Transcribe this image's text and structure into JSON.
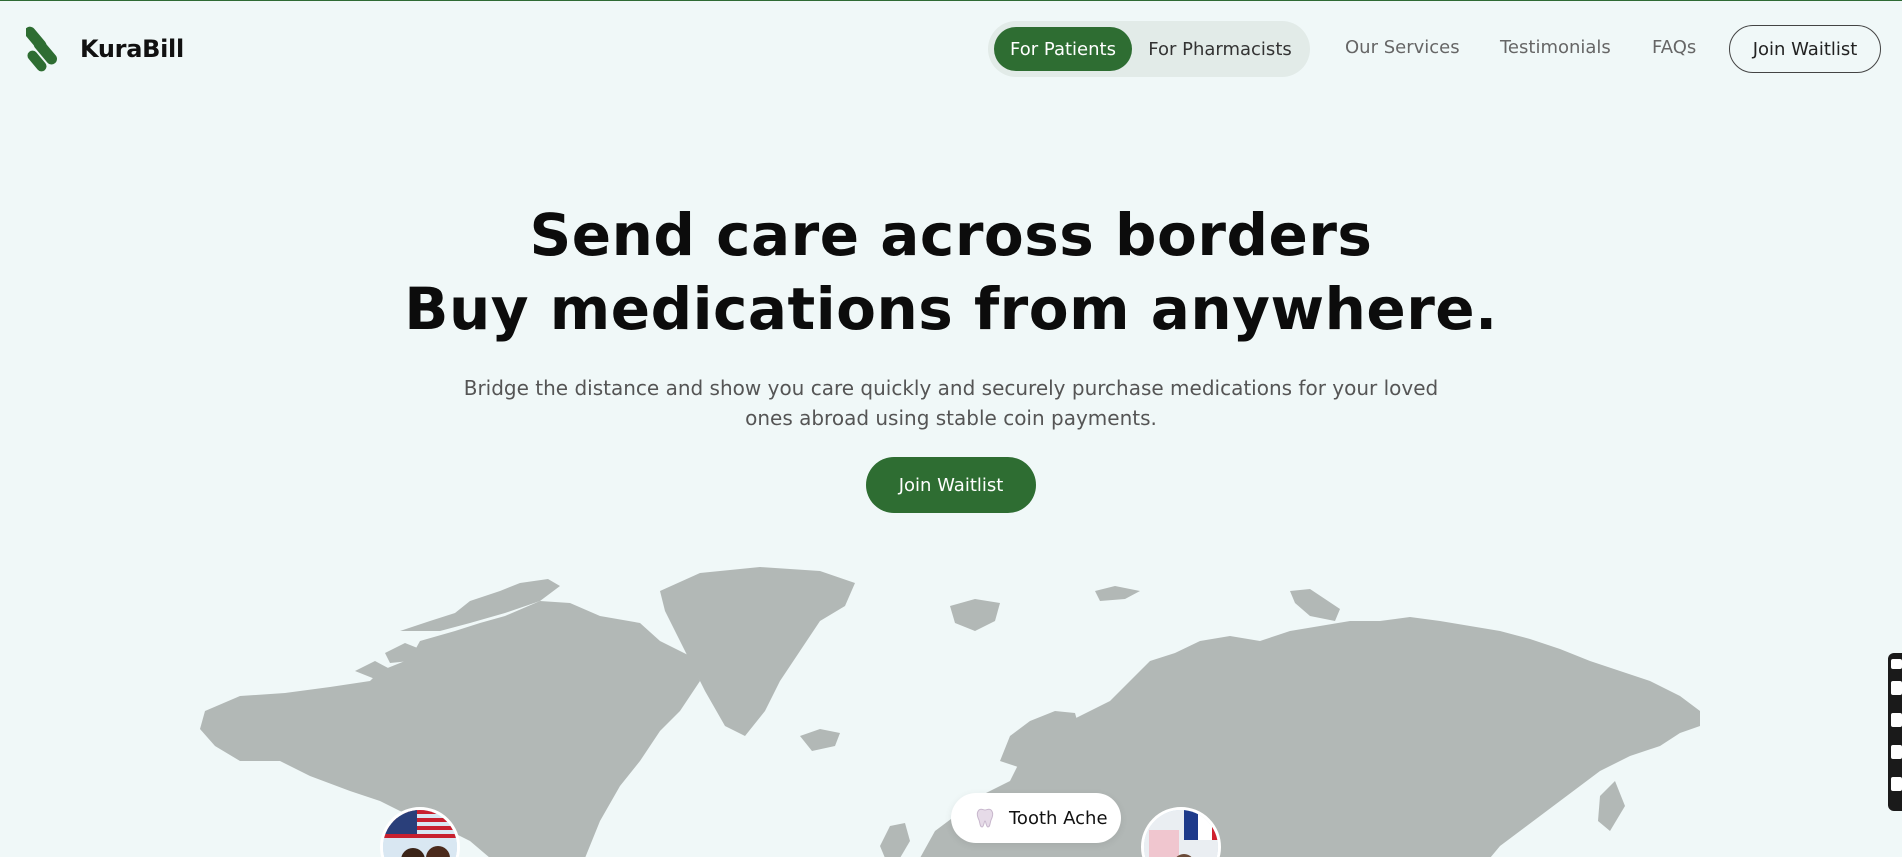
{
  "brand": {
    "name": "KuraBill",
    "color": "#2e6d32"
  },
  "nav": {
    "toggle": {
      "active": "For Patients",
      "inactive": "For Pharmacists"
    },
    "links": [
      "Our Services",
      "Testimonials",
      "FAQs"
    ],
    "cta": "Join Waitlist"
  },
  "hero": {
    "title_line1": "Send care across borders",
    "title_line2": "Buy medications from anywhere.",
    "subtitle": "Bridge the distance and show you care quickly and securely purchase medications for your loved ones abroad using stable coin payments.",
    "cta": "Join Waitlist"
  },
  "map": {
    "pill_label": "Tooth Ache",
    "pill_icon": "tooth-icon"
  },
  "colors": {
    "background": "#f0f8f8",
    "land": "#b2b8b6",
    "accent": "#2e6d32"
  }
}
